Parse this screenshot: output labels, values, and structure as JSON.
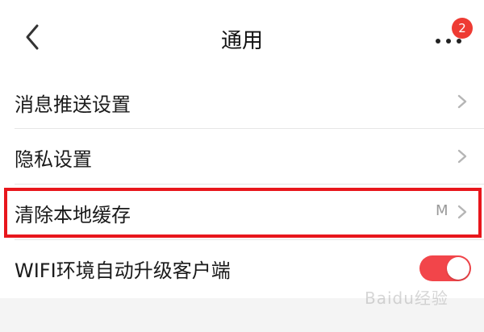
{
  "header": {
    "title": "通用",
    "badge_count": "2",
    "back_icon": "chevron-left-icon",
    "more_icon": "more-dots-icon"
  },
  "settings": [
    {
      "label": "消息推送设置",
      "type": "link"
    },
    {
      "label": "隐私设置",
      "type": "link"
    },
    {
      "label": "清除本地缓存",
      "type": "link",
      "value": "M"
    },
    {
      "label": "WIFI环境自动升级客户端",
      "type": "toggle",
      "toggle_on": true
    }
  ],
  "watermark": "Baidu经验",
  "colors": {
    "badge": "#ee3b33",
    "toggle_on": "#f2454a",
    "highlight": "#e8161c"
  }
}
